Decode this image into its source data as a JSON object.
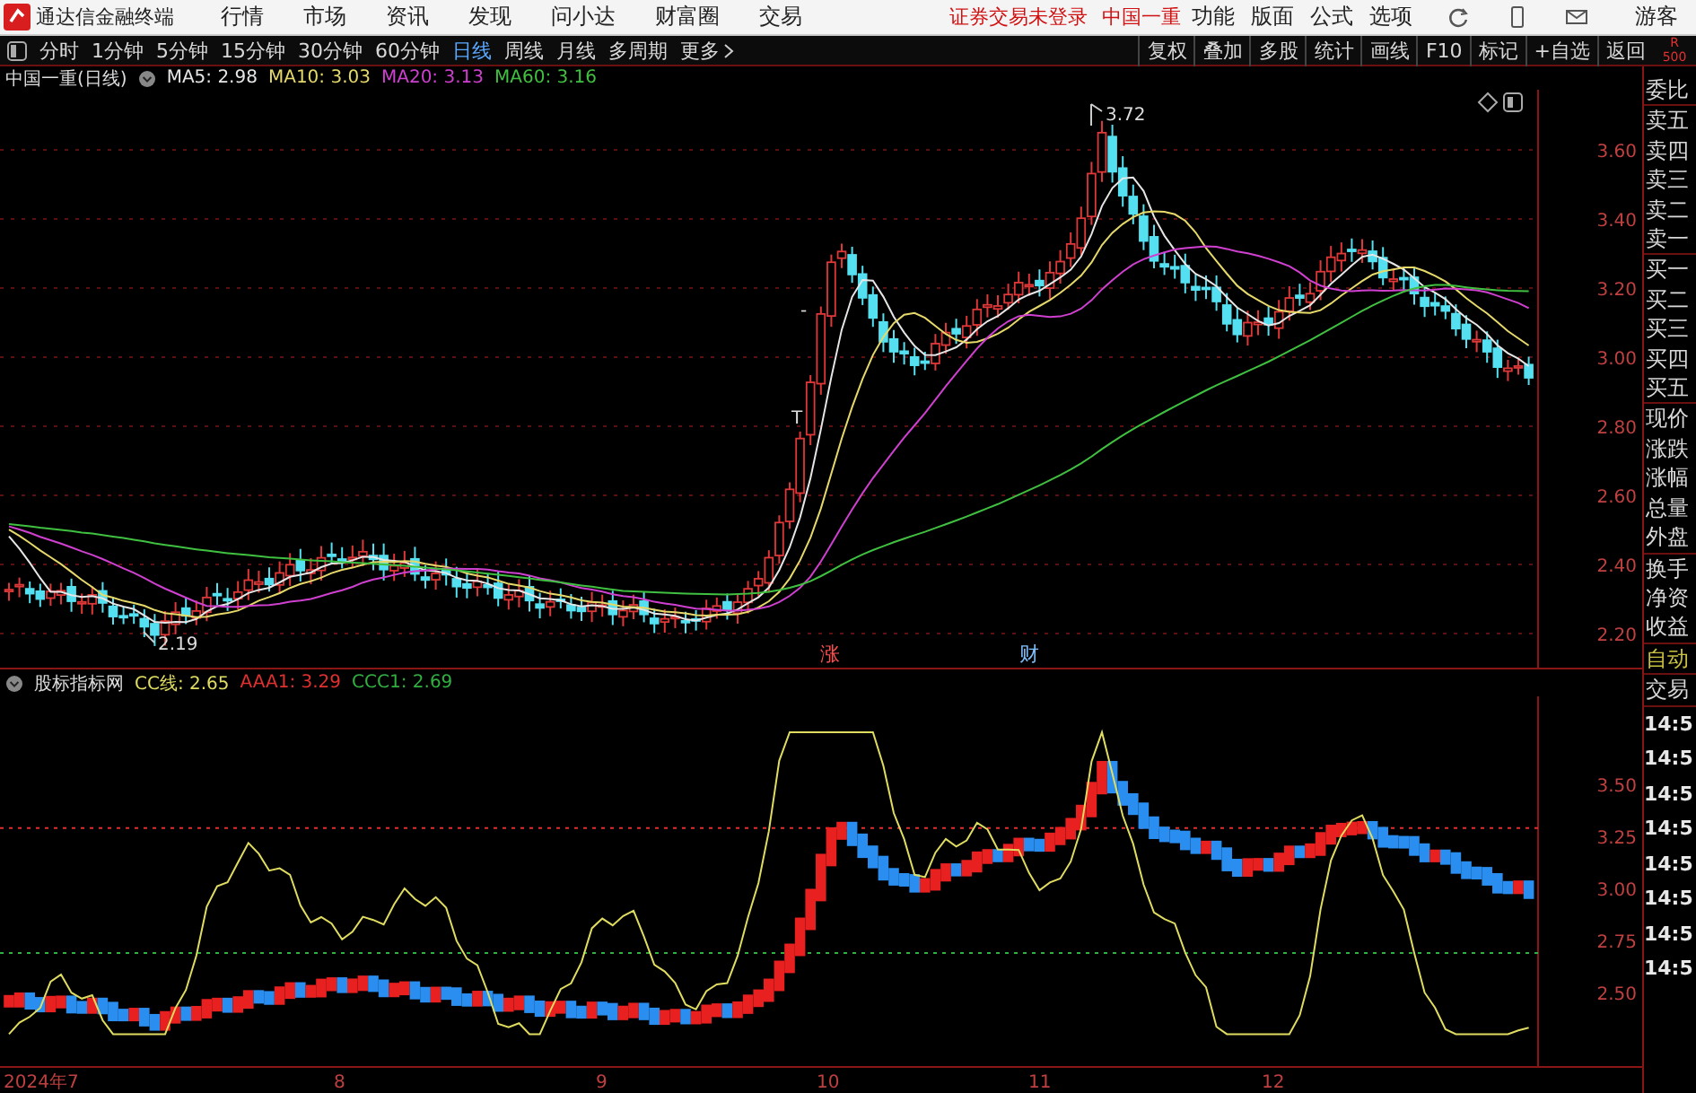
{
  "app_bar": {
    "title": "通达信金融终端",
    "menu": [
      "行情",
      "市场",
      "资讯",
      "发现",
      "问小达",
      "财富圈",
      "交易"
    ],
    "notice": "证券交易未登录",
    "stock": "中国一重",
    "tools": [
      "功能",
      "版面",
      "公式",
      "选项"
    ],
    "user": "游客"
  },
  "toolbar": {
    "periods": [
      {
        "label": "分时",
        "selected": false
      },
      {
        "label": "1分钟",
        "selected": false
      },
      {
        "label": "5分钟",
        "selected": false
      },
      {
        "label": "15分钟",
        "selected": false
      },
      {
        "label": "30分钟",
        "selected": false
      },
      {
        "label": "60分钟",
        "selected": false
      },
      {
        "label": "日线",
        "selected": true
      },
      {
        "label": "周线",
        "selected": false
      },
      {
        "label": "月线",
        "selected": false
      },
      {
        "label": "多周期",
        "selected": false
      }
    ],
    "more": "更多",
    "buttons": [
      "复权",
      "叠加",
      "多股",
      "统计",
      "画线",
      "F10",
      "标记",
      "+自选",
      "返回"
    ],
    "corner": [
      "R",
      "500"
    ]
  },
  "price_panel": {
    "title": "中国一重(日线)",
    "mas": [
      {
        "label": "MA5: 2.98",
        "color": "#e6e6e6"
      },
      {
        "label": "MA10: 3.03",
        "color": "#e6d96a"
      },
      {
        "label": "MA20: 3.13",
        "color": "#d040d0"
      },
      {
        "label": "MA60: 3.16",
        "color": "#40c040"
      }
    ],
    "y_axis": [
      "3.60",
      "3.40",
      "3.20",
      "3.00",
      "2.80",
      "2.60",
      "2.40",
      "2.20"
    ],
    "annotations": [
      {
        "kind": "high",
        "text": "3.72"
      },
      {
        "kind": "low",
        "text": "2.19"
      },
      {
        "kind": "mark",
        "text": "T"
      },
      {
        "kind": "mark",
        "text": "-"
      },
      {
        "kind": "rise_tag",
        "text": "涨"
      },
      {
        "kind": "news_tag",
        "text": "财"
      }
    ]
  },
  "indicator_panel": {
    "title": "股标指标网",
    "lines": [
      {
        "label": "CC线: 2.65",
        "color": "#e0dc60"
      },
      {
        "label": "AAA1: 3.29",
        "color": "#e03030"
      },
      {
        "label": "CCC1: 2.69",
        "color": "#30b040"
      }
    ],
    "y_axis": [
      "3.50",
      "3.25",
      "3.00",
      "2.75",
      "2.50"
    ]
  },
  "date_axis": [
    "2024年7",
    "8",
    "9",
    "10",
    "11",
    "12"
  ],
  "sidebar": {
    "groups": [
      [
        "委比"
      ],
      [
        "卖五",
        "卖四",
        "卖三",
        "卖二",
        "卖一"
      ],
      [
        "买一",
        "买二",
        "买三",
        "买四",
        "买五"
      ],
      [
        "现价",
        "涨跌",
        "涨幅",
        "总量",
        "外盘"
      ],
      [
        "换手",
        "净资",
        "收益"
      ]
    ],
    "mode": "自动",
    "trade": "交易",
    "times": [
      "14:5",
      "14:5",
      "14:5",
      "14:5",
      "14:5",
      "14:5",
      "14:5",
      "14:5"
    ]
  }
}
